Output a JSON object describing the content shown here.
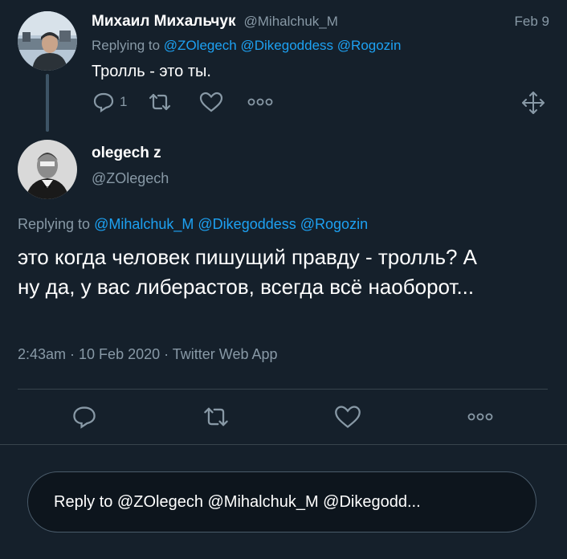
{
  "parent_tweet": {
    "display_name": "Михаил Михальчук",
    "handle": "@Mihalchuk_M",
    "date": "Feb 9",
    "replying_prefix": "Replying to",
    "replying_handles": [
      "@ZOlegech",
      "@Dikegoddess",
      "@Rogozin"
    ],
    "text": "Тролль - это ты.",
    "reply_count": "1"
  },
  "main_tweet": {
    "display_name": "olegech z",
    "handle": "@ZOlegech",
    "replying_prefix": "Replying to",
    "replying_handles": [
      "@Mihalchuk_M",
      "@Dikegoddess",
      "@Rogozin"
    ],
    "text": "это когда человек пишущий правду - тролль? А ну да, у вас либерастов, всегда всё наоборот...",
    "timestamp": "2:43am · 10 Feb 2020 · Twitter Web App"
  },
  "reply_box": {
    "placeholder": "Reply to @ZOlegech @Mihalchuk_M @Dikegodd..."
  },
  "colors": {
    "background": "#15202b",
    "accent": "#1da1f2",
    "muted": "#8899a6",
    "divider": "#38444d"
  },
  "icons": {
    "reply": "reply-icon",
    "retweet": "retweet-icon",
    "like": "heart-icon",
    "more": "more-icon",
    "expand": "move-icon"
  }
}
